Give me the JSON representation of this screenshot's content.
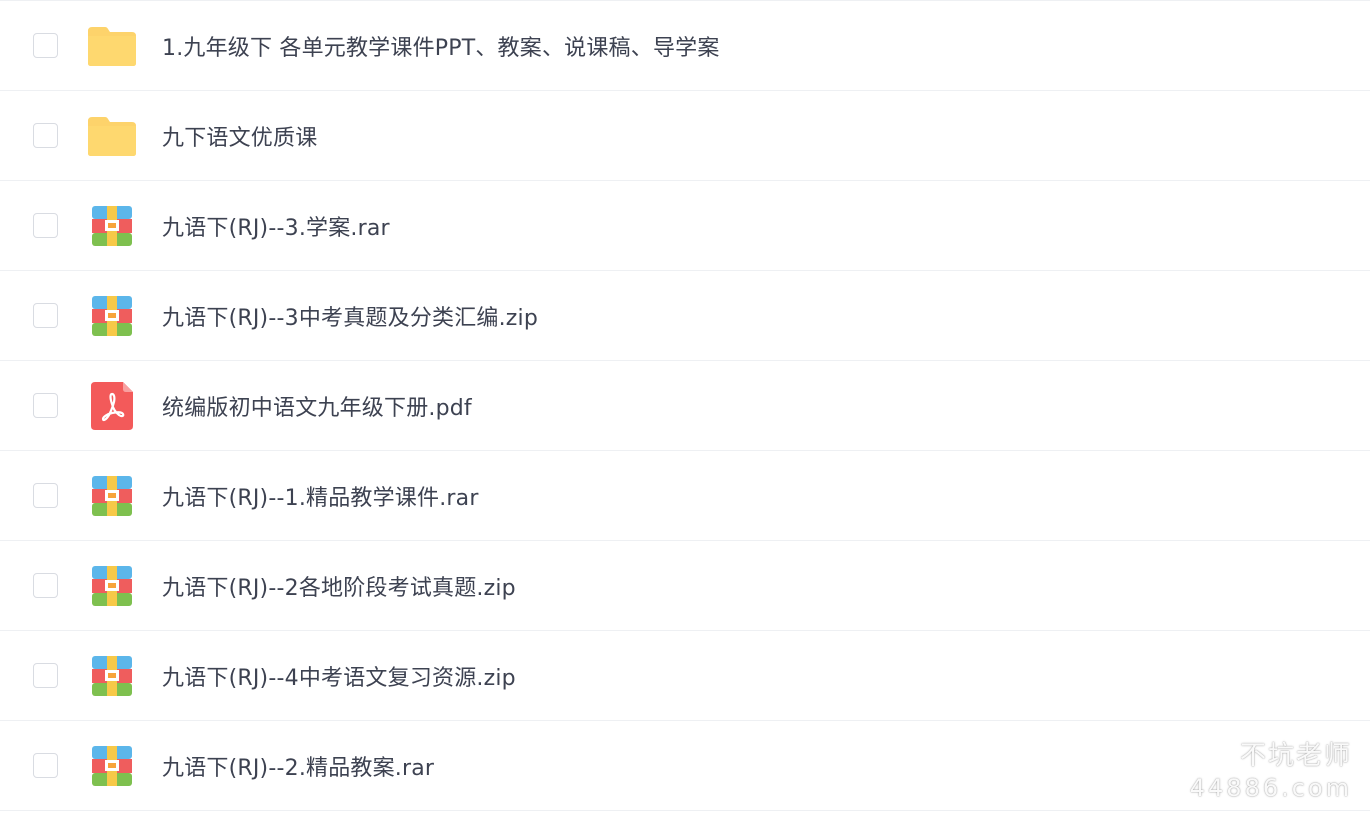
{
  "files": [
    {
      "name": "1.九年级下 各单元教学课件PPT、教案、说课稿、导学案",
      "icon": "folder-icon"
    },
    {
      "name": "九下语文优质课",
      "icon": "folder-icon"
    },
    {
      "name": "九语下(RJ)--3.学案.rar",
      "icon": "archive-icon"
    },
    {
      "name": "九语下(RJ)--3中考真题及分类汇编.zip",
      "icon": "archive-icon"
    },
    {
      "name": "统编版初中语文九年级下册.pdf",
      "icon": "pdf-icon"
    },
    {
      "name": "九语下(RJ)--1.精品教学课件.rar",
      "icon": "archive-icon"
    },
    {
      "name": "九语下(RJ)--2各地阶段考试真题.zip",
      "icon": "archive-icon"
    },
    {
      "name": "九语下(RJ)--4中考语文复习资源.zip",
      "icon": "archive-icon"
    },
    {
      "name": "九语下(RJ)--2.精品教案.rar",
      "icon": "archive-icon"
    }
  ],
  "watermark": {
    "brand": "不坑老师",
    "site": "44886.com"
  },
  "colors": {
    "folder": "#fdd36b",
    "pdf": "#f35a5a",
    "archive_blue": "#5cb6ea",
    "archive_red": "#ef5d5d",
    "archive_green": "#7ec04f",
    "archive_yellow": "#f7c948"
  }
}
